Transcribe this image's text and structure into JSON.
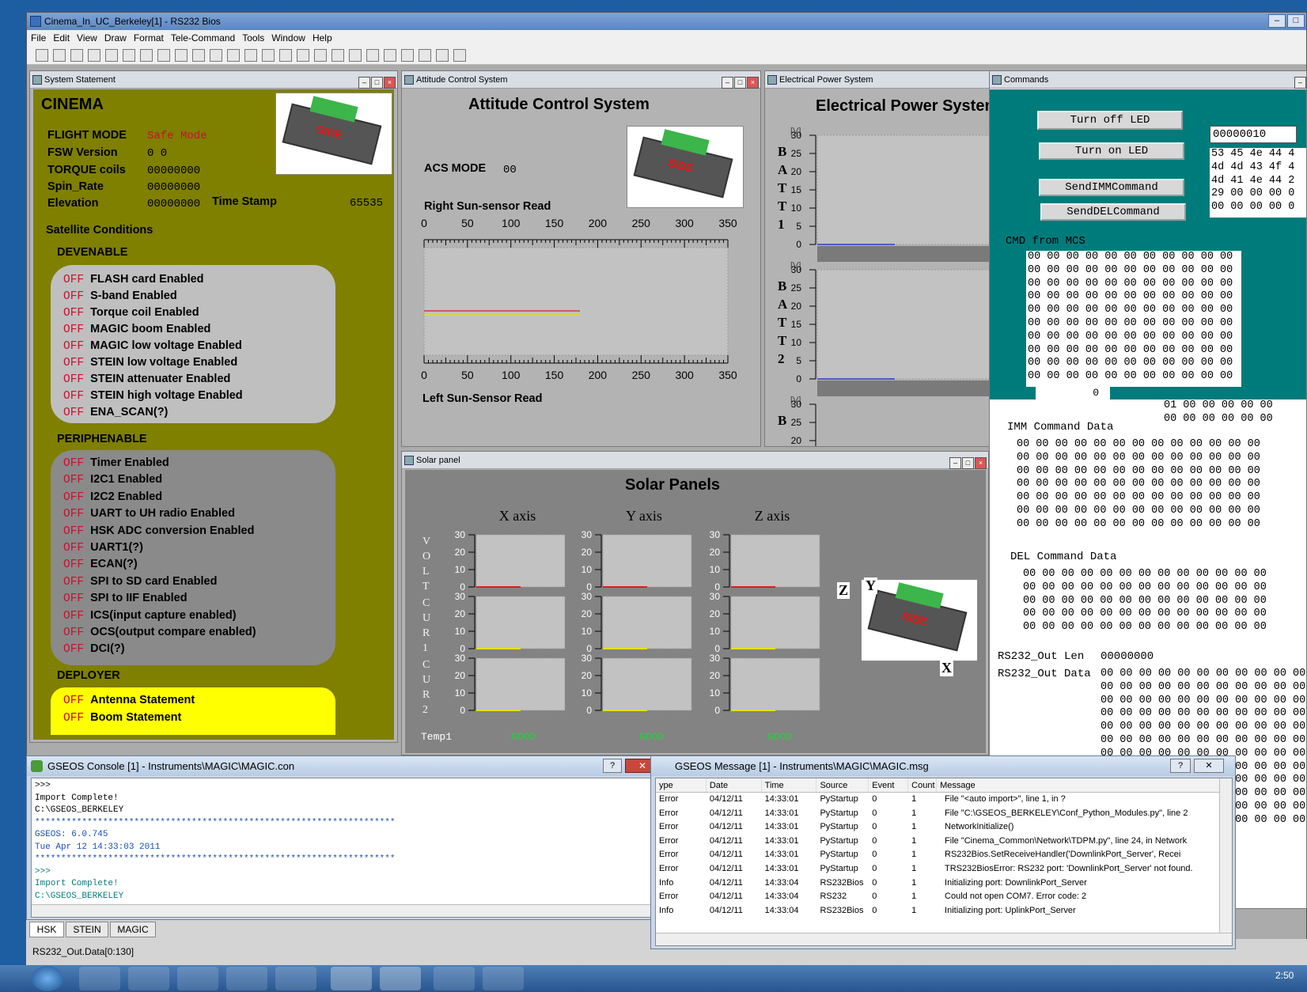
{
  "app": {
    "title": "Cinema_In_UC_Berkeley[1] - RS232 Bios"
  },
  "menu": [
    "File",
    "Edit",
    "View",
    "Draw",
    "Format",
    "Tele-Command",
    "Tools",
    "Window",
    "Help"
  ],
  "system": {
    "window_title": "System Statement",
    "header": "CINEMA",
    "flight_mode_label": "FLIGHT MODE",
    "flight_mode_value": "Safe Mode",
    "fsw_label": "FSW Version",
    "fsw_value": "0 0",
    "torque_label": "TORQUE coils",
    "torque_value": "00000000",
    "spin_label": "Spin_Rate",
    "spin_value": "00000000",
    "elev_label": "Elevation",
    "elev_value": "00000000",
    "timestamp_label": "Time Stamp",
    "timestamp_value": "65535",
    "sat_conditions": "Satellite Conditions",
    "devenable": "DEVENABLE",
    "dev_items": [
      "FLASH card Enabled",
      "S-band Enabled",
      "Torque coil Enabled",
      "MAGIC boom Enabled",
      "MAGIC low voltage Enabled",
      "STEIN low voltage Enabled",
      "STEIN attenuater Enabled",
      "STEIN high voltage Enabled",
      "ENA_SCAN(?)"
    ],
    "periphenable": "PERIPHENABLE",
    "peri_items": [
      "Timer Enabled",
      "I2C1 Enabled",
      "I2C2 Enabled",
      "UART to UH radio Enabled",
      "HSK ADC conversion Enabled",
      "UART1(?)",
      "ECAN(?)",
      "SPI to SD card Enabled",
      "SPI to IIF Enabled",
      "ICS(input capture enabled)",
      "OCS(output compare enabled)",
      "DCI(?)"
    ],
    "deployer": "DEPLOYER",
    "deploy_items": [
      "Antenna Statement",
      "Boom Statement"
    ],
    "off": "OFF",
    "sat_label": "SIDE"
  },
  "acs": {
    "window_title": "Attitude Control System",
    "header": "Attitude Control System",
    "mode_label": "ACS MODE",
    "mode_value": "00",
    "right_label": "Right Sun-sensor Read",
    "left_label": "Left Sun-Sensor Read",
    "ticks": [
      "0",
      "50",
      "100",
      "150",
      "200",
      "250",
      "300",
      "350"
    ]
  },
  "eps": {
    "window_title": "Electrical Power System",
    "header": "Electrical Power System",
    "unit": "[V]",
    "bat_letters_1": [
      "B",
      "A",
      "T",
      "T",
      "1"
    ],
    "bat_letters_2": [
      "B",
      "A",
      "T",
      "T",
      "2"
    ],
    "bat_letters_3": [
      "B"
    ],
    "yticks": [
      "30",
      "25",
      "20",
      "15",
      "10",
      "5",
      "0"
    ]
  },
  "solar": {
    "window_title": "Solar panel",
    "header": "Solar Panels",
    "axes": [
      "X axis",
      "Y axis",
      "Z axis"
    ],
    "row_labels": [
      [
        "V",
        "O",
        "L",
        "T"
      ],
      [
        "C",
        "U",
        "R",
        "1"
      ],
      [
        "C",
        "U",
        "R",
        "2"
      ]
    ],
    "yticks": [
      "30",
      "20",
      "10",
      "0"
    ],
    "temp_label": "Temp1",
    "good": "GOOD",
    "coord": [
      "Z",
      "Y",
      "X"
    ]
  },
  "commands": {
    "window_title": "Commands",
    "btn_led_off": "Turn off LED",
    "btn_led_on": "Turn on LED",
    "btn_imm": "SendIMMCommand",
    "btn_del": "SendDELCommand",
    "value_box": "00000010",
    "hex_rows": [
      "53 45 4e 44 4",
      "4d 4d 43 4f 4",
      "4d 41 4e 44 2",
      "29 00 00 00 0",
      "00 00 00 00 0"
    ],
    "cmd_from_mcs": "CMD from MCS",
    "mcs_row": "00 00 00 00 00 00 00 00 00 00 00",
    "counter": "0",
    "mcs_tail1": "01 00 00 00 00 00",
    "mcs_tail2": "00 00 00 00 00 00",
    "imm_label": "IMM Command Data",
    "imm_row": "00 00 00 00 00 00 00 00 00 00 00 00 00",
    "del_label": "DEL Command Data",
    "del_row": "00 00 00 00 00 00 00 00 00 00 00 00 00",
    "out_len_label": "RS232_Out Len",
    "out_len_value": "00000000",
    "out_data_label": "RS232_Out Data",
    "out_row": "00 00 00 00 00 00 00 00 00 00 00"
  },
  "console": {
    "window_title": "GSEOS Console  [1] - Instruments\\MAGIC\\MAGIC.con",
    "lines": [
      ">>>",
      "Import Complete!",
      "C:\\GSEOS_BERKELEY",
      "*********************************************************************",
      "GSEOS: 6.0.745",
      "Tue Apr 12 14:33:03 2011",
      "*********************************************************************",
      ">>>",
      "Import Complete!",
      "C:\\GSEOS_BERKELEY"
    ],
    "tabs": [
      "HSK",
      "STEIN",
      "MAGIC"
    ]
  },
  "messages": {
    "window_title": "GSEOS Message [1] - Instruments\\MAGIC\\MAGIC.msg",
    "columns": [
      "ype",
      "Date",
      "Time",
      "Source",
      "Event",
      "Count",
      "Message"
    ],
    "rows": [
      [
        "Error",
        "04/12/11",
        "14:33:01",
        "PyStartup",
        "0",
        "1",
        "File \"<auto import>\", line 1, in ?"
      ],
      [
        "Error",
        "04/12/11",
        "14:33:01",
        "PyStartup",
        "0",
        "1",
        "File \"C:\\GSEOS_BERKELEY\\Conf_Python_Modules.py\", line 2"
      ],
      [
        "Error",
        "04/12/11",
        "14:33:01",
        "PyStartup",
        "0",
        "1",
        "NetworkInitialize()"
      ],
      [
        "Error",
        "04/12/11",
        "14:33:01",
        "PyStartup",
        "0",
        "1",
        "File \"Cinema_Common\\Network\\TDPM.py\", line 24, in Network"
      ],
      [
        "Error",
        "04/12/11",
        "14:33:01",
        "PyStartup",
        "0",
        "1",
        "RS232Bios.SetReceiveHandler('DownlinkPort_Server', Recei"
      ],
      [
        "Error",
        "04/12/11",
        "14:33:01",
        "PyStartup",
        "0",
        "1",
        "TRS232BiosError: RS232 port: 'DownlinkPort_Server' not found."
      ],
      [
        "Info",
        "04/12/11",
        "14:33:04",
        "RS232Bios",
        "0",
        "1",
        "Initializing port: DownlinkPort_Server"
      ],
      [
        "Error",
        "04/12/11",
        "14:33:04",
        "RS232",
        "0",
        "1",
        "Could not open COM7. Error code: 2"
      ],
      [
        "Info",
        "04/12/11",
        "14:33:04",
        "RS232Bios",
        "0",
        "1",
        "Initializing port: UplinkPort_Server"
      ]
    ]
  },
  "status": {
    "text": "RS232_Out.Data[0:130]"
  },
  "clock": {
    "time": "2:50"
  },
  "colors": {
    "olive": "#7f7f00",
    "teal": "#007b7b",
    "red": "#c8102e",
    "good": "#2ecc40"
  }
}
